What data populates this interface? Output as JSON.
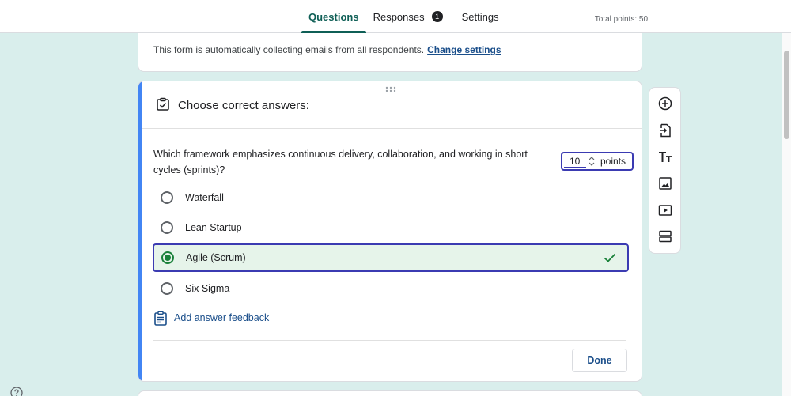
{
  "tabs": [
    {
      "label": "Questions"
    },
    {
      "label": "Responses",
      "badge": "1"
    },
    {
      "label": "Settings"
    }
  ],
  "total_points": "Total points: 50",
  "notice": {
    "text": "This form is automatically collecting emails from all respondents.",
    "link": "Change settings"
  },
  "card": {
    "header_title": "Choose correct answers:",
    "question": "Which framework emphasizes continuous delivery, collaboration, and working in short cycles (sprints)?",
    "points_value": "10",
    "points_label": "points",
    "options": [
      {
        "label": "Waterfall",
        "correct": false
      },
      {
        "label": "Lean Startup",
        "correct": false
      },
      {
        "label": "Agile (Scrum)",
        "correct": true
      },
      {
        "label": "Six Sigma",
        "correct": false
      }
    ],
    "feedback_label": "Add answer feedback",
    "done_label": "Done"
  },
  "toolbar_icons": [
    "add-question-icon",
    "import-questions-icon",
    "add-title-icon",
    "add-image-icon",
    "add-video-icon",
    "add-section-icon"
  ],
  "colors": {
    "background": "#d9eeec",
    "accent": "#0f5f56",
    "card_accent": "#4285f4",
    "correct_bg": "#e6f4ea",
    "correct_green": "#188038",
    "selection_border": "#3b3bb2"
  }
}
